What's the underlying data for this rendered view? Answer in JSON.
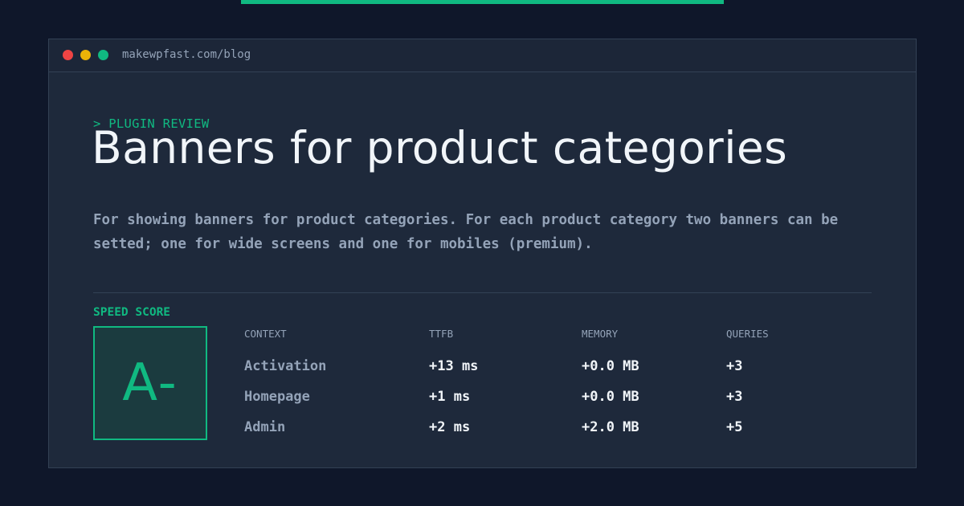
{
  "accent_color": "#10b981",
  "window": {
    "url": "makewpfast.com/blog",
    "dots": [
      {
        "name": "close-dot",
        "color": "#ef4444"
      },
      {
        "name": "minimize-dot",
        "color": "#eab308"
      },
      {
        "name": "maximize-dot",
        "color": "#10b981"
      }
    ]
  },
  "post": {
    "kicker": "> PLUGIN REVIEW",
    "title": "Banners for product categories",
    "description": "For showing banners for product categories. For each product category two banners can be setted; one for wide screens and one for mobiles (premium)."
  },
  "score": {
    "label": "SPEED SCORE",
    "grade": "A-"
  },
  "table": {
    "headers": [
      "CONTEXT",
      "TTFB",
      "MEMORY",
      "QUERIES"
    ],
    "rows": [
      {
        "context": "Activation",
        "ttfb": "+13 ms",
        "memory": "+0.0 MB",
        "queries": "+3"
      },
      {
        "context": "Homepage",
        "ttfb": "+1 ms",
        "memory": "+0.0 MB",
        "queries": "+3"
      },
      {
        "context": "Admin",
        "ttfb": "+2 ms",
        "memory": "+2.0 MB",
        "queries": "+5"
      }
    ]
  }
}
